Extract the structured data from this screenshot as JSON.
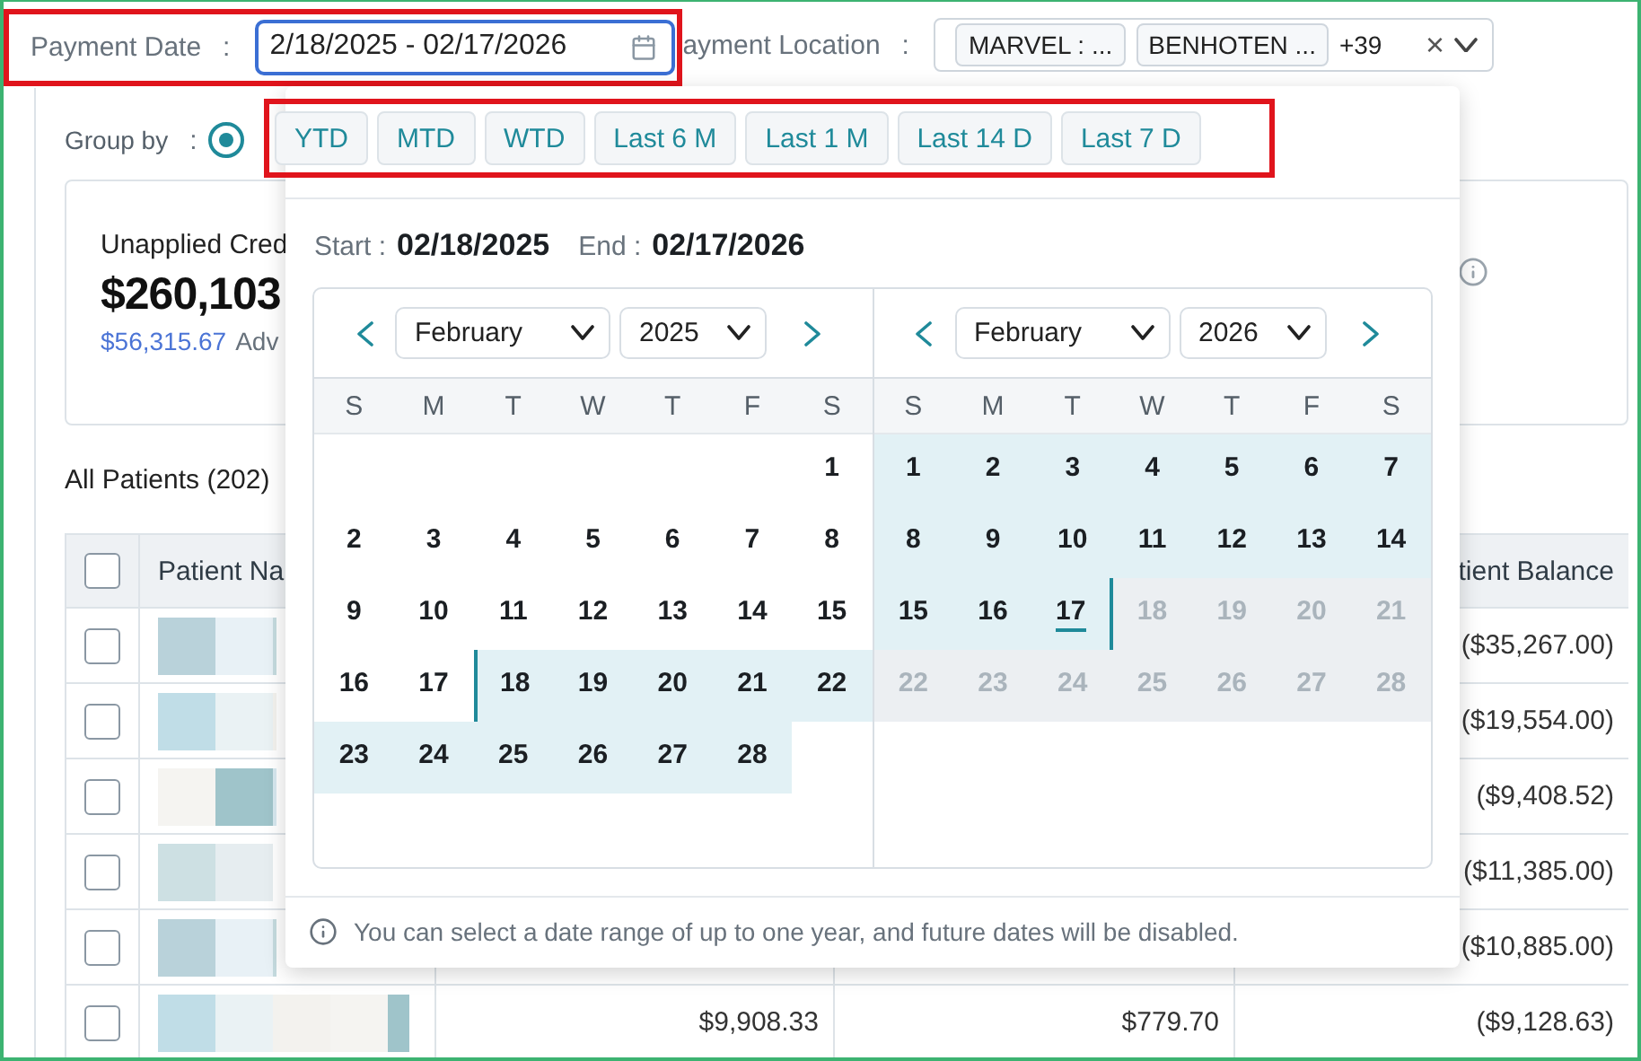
{
  "filters": {
    "payment_date": {
      "label": "Payment Date",
      "separator": ":",
      "value": "2/18/2025 - 02/17/2026"
    },
    "payment_location": {
      "label": "ayment Location",
      "separator": ":",
      "chips": [
        "MARVEL : ...",
        "BENHOTEN ..."
      ],
      "more": "+39",
      "clear": "×"
    }
  },
  "group_by": {
    "label": "Group by",
    "separator": ":",
    "selected": true
  },
  "summary_card": {
    "title": "Unapplied Cred",
    "amount": "$260,103",
    "sub_amount": "$56,315.67",
    "sub_label": "Adv"
  },
  "patients_title": "All Patients (202)",
  "table": {
    "header_checked": false,
    "columns": [
      {
        "label": "Patient Na"
      },
      {
        "label": "tient Balance"
      }
    ],
    "rows": [
      {
        "checked": false,
        "balance": "($35,267.00)"
      },
      {
        "checked": false,
        "balance": "($19,554.00)"
      },
      {
        "checked": false,
        "balance": "($9,408.52)"
      },
      {
        "checked": false,
        "balance": "($11,385.00)"
      },
      {
        "checked": false,
        "balance": "($10,885.00)"
      },
      {
        "checked": false,
        "column_3": "$9,908.33",
        "column_4": "$779.70",
        "balance": "($9,128.63)"
      }
    ]
  },
  "date_picker": {
    "presets": [
      "YTD",
      "MTD",
      "WTD",
      "Last 6 M",
      "Last 1 M",
      "Last 14 D",
      "Last 7 D"
    ],
    "start_label": "Start :",
    "start": "02/18/2025",
    "end_label": "End :",
    "end": "02/17/2026",
    "months": [
      {
        "month": "February",
        "year": "2025",
        "weekdays": [
          "S",
          "M",
          "T",
          "W",
          "T",
          "F",
          "S"
        ],
        "days": [
          {
            "kind": "blank"
          },
          {
            "kind": "blank"
          },
          {
            "kind": "blank"
          },
          {
            "kind": "blank"
          },
          {
            "kind": "blank"
          },
          {
            "kind": "blank"
          },
          {
            "text": "1",
            "kind": "normal"
          },
          {
            "text": "2",
            "kind": "normal"
          },
          {
            "text": "3",
            "kind": "normal"
          },
          {
            "text": "4",
            "kind": "normal"
          },
          {
            "text": "5",
            "kind": "normal"
          },
          {
            "text": "6",
            "kind": "normal"
          },
          {
            "text": "7",
            "kind": "normal"
          },
          {
            "text": "8",
            "kind": "normal"
          },
          {
            "text": "9",
            "kind": "normal"
          },
          {
            "text": "10",
            "kind": "normal"
          },
          {
            "text": "11",
            "kind": "normal"
          },
          {
            "text": "12",
            "kind": "normal"
          },
          {
            "text": "13",
            "kind": "normal"
          },
          {
            "text": "14",
            "kind": "normal"
          },
          {
            "text": "15",
            "kind": "normal"
          },
          {
            "text": "16",
            "kind": "normal"
          },
          {
            "text": "17",
            "kind": "normal"
          },
          {
            "text": "18",
            "kind": "start"
          },
          {
            "text": "19",
            "kind": "range"
          },
          {
            "text": "20",
            "kind": "range"
          },
          {
            "text": "21",
            "kind": "range"
          },
          {
            "text": "22",
            "kind": "range"
          },
          {
            "text": "23",
            "kind": "range"
          },
          {
            "text": "24",
            "kind": "range"
          },
          {
            "text": "25",
            "kind": "range"
          },
          {
            "text": "26",
            "kind": "range"
          },
          {
            "text": "27",
            "kind": "range"
          },
          {
            "text": "28",
            "kind": "range"
          }
        ]
      },
      {
        "month": "February",
        "year": "2026",
        "weekdays": [
          "S",
          "M",
          "T",
          "W",
          "T",
          "F",
          "S"
        ],
        "days": [
          {
            "text": "1",
            "kind": "range"
          },
          {
            "text": "2",
            "kind": "range"
          },
          {
            "text": "3",
            "kind": "range"
          },
          {
            "text": "4",
            "kind": "range"
          },
          {
            "text": "5",
            "kind": "range"
          },
          {
            "text": "6",
            "kind": "range"
          },
          {
            "text": "7",
            "kind": "range"
          },
          {
            "text": "8",
            "kind": "range"
          },
          {
            "text": "9",
            "kind": "range"
          },
          {
            "text": "10",
            "kind": "range"
          },
          {
            "text": "11",
            "kind": "range"
          },
          {
            "text": "12",
            "kind": "range"
          },
          {
            "text": "13",
            "kind": "range"
          },
          {
            "text": "14",
            "kind": "range"
          },
          {
            "text": "15",
            "kind": "range"
          },
          {
            "text": "16",
            "kind": "range"
          },
          {
            "text": "17",
            "kind": "end"
          },
          {
            "text": "18",
            "kind": "disabled"
          },
          {
            "text": "19",
            "kind": "disabled"
          },
          {
            "text": "20",
            "kind": "disabled"
          },
          {
            "text": "21",
            "kind": "disabled"
          },
          {
            "text": "22",
            "kind": "disabled"
          },
          {
            "text": "23",
            "kind": "disabled"
          },
          {
            "text": "24",
            "kind": "disabled"
          },
          {
            "text": "25",
            "kind": "disabled"
          },
          {
            "text": "26",
            "kind": "disabled"
          },
          {
            "text": "27",
            "kind": "disabled"
          },
          {
            "text": "28",
            "kind": "disabled"
          }
        ]
      }
    ],
    "note": "You can select a date range of up to one year, and future dates will be disabled."
  }
}
